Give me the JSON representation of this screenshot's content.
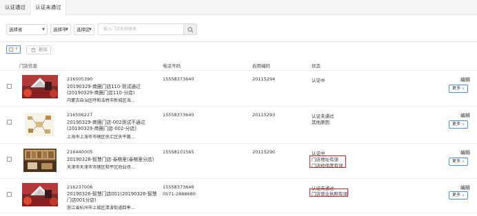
{
  "tabs": [
    {
      "label": "认证通过"
    },
    {
      "label": "认证未通过"
    }
  ],
  "filters": {
    "province": "选择省",
    "city": "选择市",
    "district": "选择区",
    "search_placeholder": "输入门店名称搜索"
  },
  "toolbar": {
    "delete_label": "删除"
  },
  "columns": {
    "store_info": "门店信息",
    "phone": "电话号码",
    "code": "自用编码",
    "status": "状态"
  },
  "rows": [
    {
      "id": "216505390",
      "name": "20190329-商圈门店110-测试通过(20190329-商圈门店110-分店)",
      "address": "内蒙古自治区呼和浩特市新城区海...",
      "phone": "15558373640",
      "phone2": "",
      "code": "20115294",
      "status": "认证中",
      "status_note": "",
      "status_note2": "",
      "edit": "编辑",
      "more": "更多"
    },
    {
      "id": "216506227",
      "name": "20190329-商圈门店-002测试不通过(20190329-商圈门店-002-分店)",
      "address": "上海市上海市市辖区徐汇区天平路...",
      "phone": "15558373640",
      "phone2": "",
      "code": "20115293",
      "status": "认证未通过",
      "status_note": "其他原因",
      "status_note2": "",
      "edit": "编辑",
      "more": "更多"
    },
    {
      "id": "216440005",
      "name": "20190328-智慧门店-泰榕里(泰榕里分店)",
      "address": "天津市天津市市辖区和平区劝业场...",
      "phone": "15558101565",
      "phone2": "",
      "code": "20115290",
      "status": "认证中",
      "status_note": "门店地址有误",
      "status_note2": "门店经纬度有误",
      "edit": "编辑",
      "more": "更多"
    },
    {
      "id": "216237006",
      "name": "20190326-智慧门店001(20190326-智慧门店001分店)",
      "address": "浙江省杭州市上城区清波街道四季...",
      "phone": "15558373646",
      "phone2": "0571-2888680",
      "code": "",
      "status": "认证未通过",
      "status_note": "门店营业执照有误",
      "status_note2": "",
      "edit": "编辑",
      "more": "更多"
    }
  ],
  "colors": {
    "accent": "#4a90e2",
    "highlight": "#e02020"
  }
}
